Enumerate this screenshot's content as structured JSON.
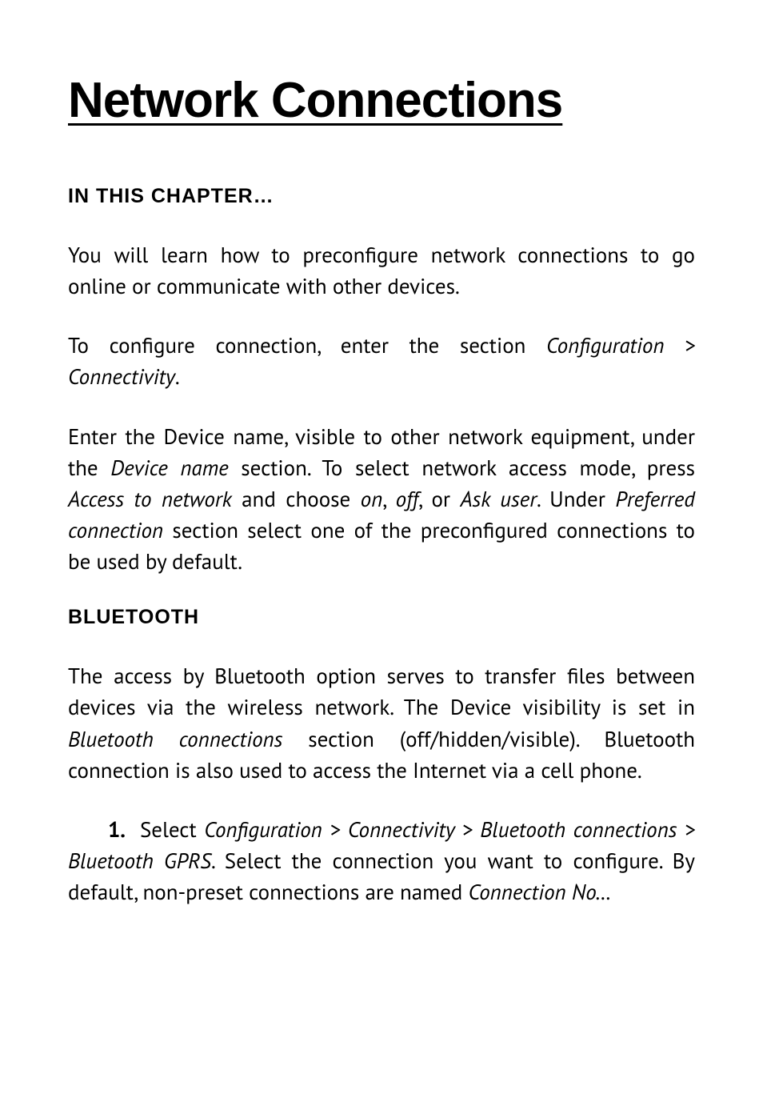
{
  "chapter": {
    "title": "Network Connections"
  },
  "sections": {
    "in_this_chapter": {
      "heading": "IN THIS CHAPTER…",
      "p1": "You will learn how to preconfigure network connections to go online or communicate with other devices.",
      "p2_pre": "To configure connection, enter the section ",
      "p2_italic": "Configuration > Connectivity",
      "p2_post": ".",
      "p3_a": "Enter the Device name, visible to other network equipment, under the ",
      "p3_i1": "Device name",
      "p3_b": " section. To select network access mode, press ",
      "p3_i2": "Access to network",
      "p3_c": " and choose ",
      "p3_i3": "on",
      "p3_d": ", ",
      "p3_i4": "off",
      "p3_e": ", or ",
      "p3_i5": "Ask user",
      "p3_f": ". Under ",
      "p3_i6": "Preferred connection",
      "p3_g": " section select one of the preconfigured connections to be used by default."
    },
    "bluetooth": {
      "heading": "BLUETOOTH",
      "p1_a": "The access by Bluetooth option serves to transfer files between devices via the wireless network. The Device visibility is set in ",
      "p1_i1": "Bluetooth connections",
      "p1_b": " section (off/hidden/visible). Bluetooth connection is also used to access the Internet via a cell phone.",
      "step1_num": "1.",
      "step1_a": "Select ",
      "step1_i1": "Configuration > Connectivity > Bluetooth connections > Bluetooth GPRS",
      "step1_b": ". Select the connection you want to configure. By default, non-preset connections are named ",
      "step1_i2": "Connection No…"
    }
  }
}
